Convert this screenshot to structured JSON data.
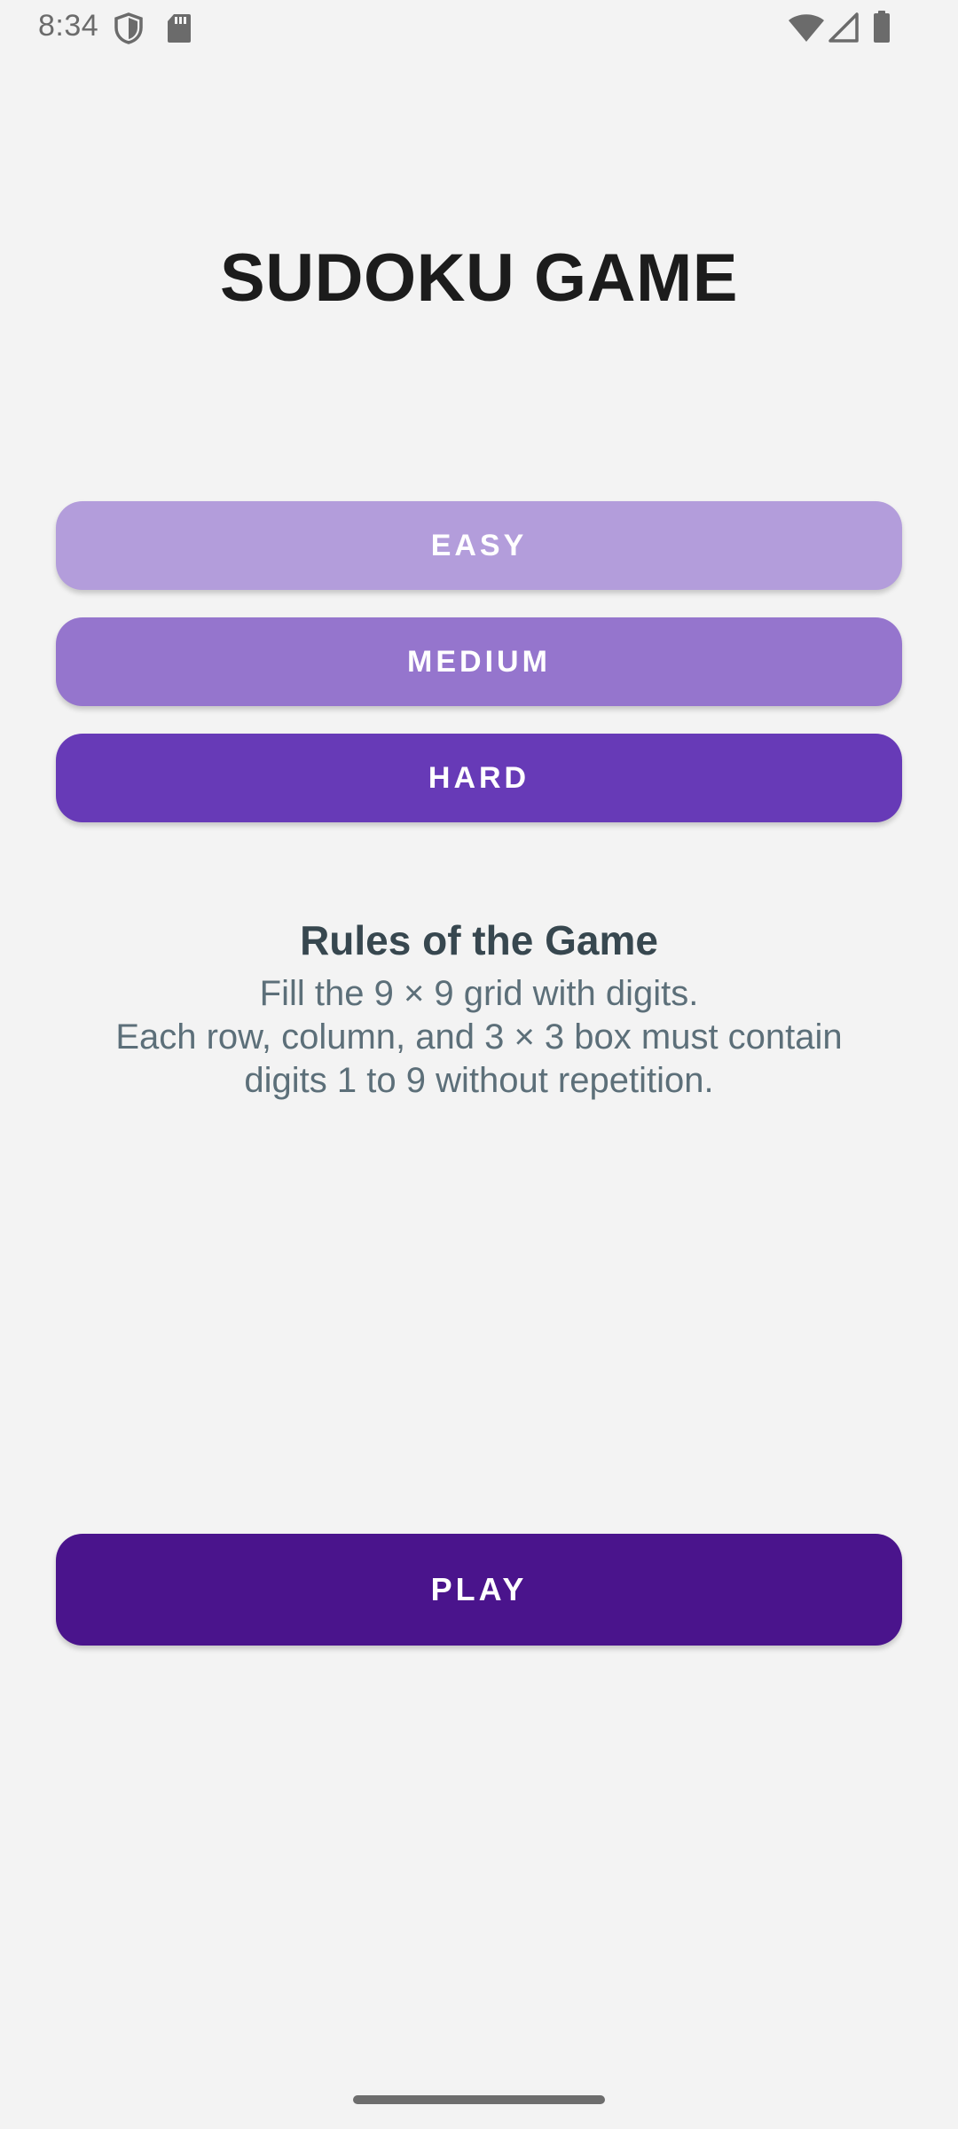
{
  "status_bar": {
    "time": "8:34",
    "icons": [
      "shield-icon",
      "sd-card-icon",
      "wifi-icon",
      "signal-icon",
      "battery-icon"
    ]
  },
  "title": "SUDOKU GAME",
  "difficulty": {
    "easy_label": "EASY",
    "medium_label": "MEDIUM",
    "hard_label": "HARD"
  },
  "rules": {
    "title": "Rules of the Game",
    "line_1": "Fill the 9 × 9 grid with digits.",
    "line_2": "Each row, column, and 3 × 3 box must contain",
    "line_3": "digits 1 to 9 without repetition."
  },
  "play_label": "PLAY",
  "colors": {
    "background": "#f3f3f3",
    "easy": "#b39ddb",
    "medium": "#9575cd",
    "hard": "#673ab7",
    "play": "#4a148c",
    "title_text": "#1c1c1c",
    "rules_title": "#37474f",
    "rules_text": "#5c6f79"
  }
}
